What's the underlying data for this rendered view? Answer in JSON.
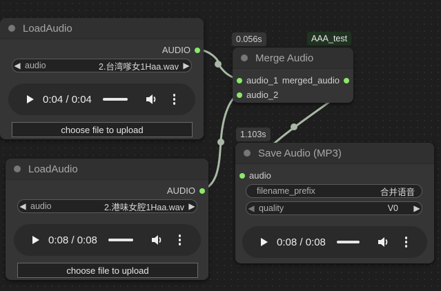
{
  "badges": {
    "merge_time": "0.056s",
    "save_time": "1.103s",
    "group_name": "AAA_test"
  },
  "load_audio_1": {
    "title": "LoadAudio",
    "output_label": "AUDIO",
    "combo_label": "audio",
    "combo_value": "2.台湾嗲女1Haa.wav",
    "player_time": "0:04 / 0:04",
    "upload_label": "choose file to upload"
  },
  "load_audio_2": {
    "title": "LoadAudio",
    "output_label": "AUDIO",
    "combo_label": "audio",
    "combo_value": "2.港味女腔1Haa.wav",
    "player_time": "0:08 / 0:08",
    "upload_label": "choose file to upload"
  },
  "merge_audio": {
    "title": "Merge Audio",
    "input_1": "audio_1",
    "input_2": "audio_2",
    "output_label": "merged_audio"
  },
  "save_audio": {
    "title": "Save Audio (MP3)",
    "input_label": "audio",
    "filename_label": "filename_prefix",
    "filename_value": "合并语音",
    "quality_label": "quality",
    "quality_value": "V0",
    "player_time": "0:08 / 0:08"
  },
  "colors": {
    "slot_green": "#8be86b",
    "link": "#a9b8a6",
    "group_badge": "#1f3320"
  },
  "icons": [
    "play-icon",
    "volume-icon",
    "more-vert-icon",
    "arrow-left-icon",
    "arrow-right-icon"
  ]
}
